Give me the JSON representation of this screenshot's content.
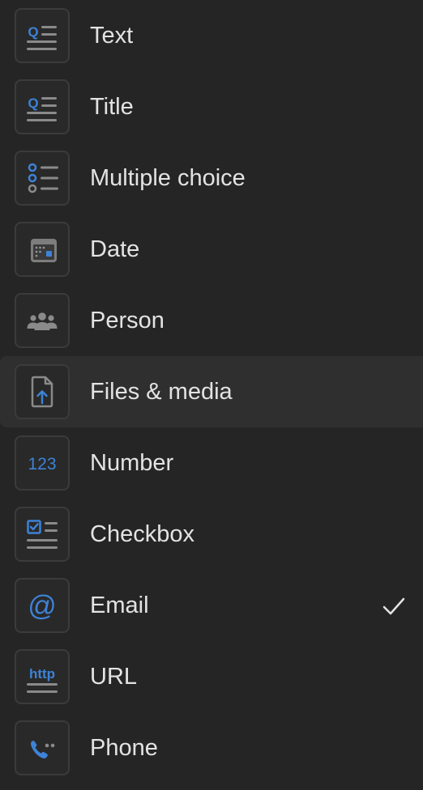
{
  "property_types": [
    {
      "label": "Text",
      "icon": "text-icon",
      "selected": false,
      "highlighted": false
    },
    {
      "label": "Title",
      "icon": "title-icon",
      "selected": false,
      "highlighted": false
    },
    {
      "label": "Multiple choice",
      "icon": "multiple-choice-icon",
      "selected": false,
      "highlighted": false
    },
    {
      "label": "Date",
      "icon": "calendar-icon",
      "selected": false,
      "highlighted": false
    },
    {
      "label": "Person",
      "icon": "people-icon",
      "selected": false,
      "highlighted": false
    },
    {
      "label": "Files & media",
      "icon": "file-upload-icon",
      "selected": false,
      "highlighted": true
    },
    {
      "label": "Number",
      "icon": "number-icon",
      "selected": false,
      "highlighted": false
    },
    {
      "label": "Checkbox",
      "icon": "checkbox-icon",
      "selected": false,
      "highlighted": false
    },
    {
      "label": "Email",
      "icon": "at-sign-icon",
      "selected": true,
      "highlighted": false
    },
    {
      "label": "URL",
      "icon": "url-icon",
      "selected": false,
      "highlighted": false
    },
    {
      "label": "Phone",
      "icon": "phone-icon",
      "selected": false,
      "highlighted": false
    }
  ],
  "icon_text": {
    "number": "123",
    "url": "http"
  },
  "colors": {
    "background": "#252525",
    "highlight": "#2f2f2f",
    "tile_border": "#3b3b3b",
    "icon_blue": "#3d82d6",
    "icon_gray": "#8a8a8a",
    "label_text": "#e3e3e3",
    "checkmark": "#e3e3e3"
  }
}
